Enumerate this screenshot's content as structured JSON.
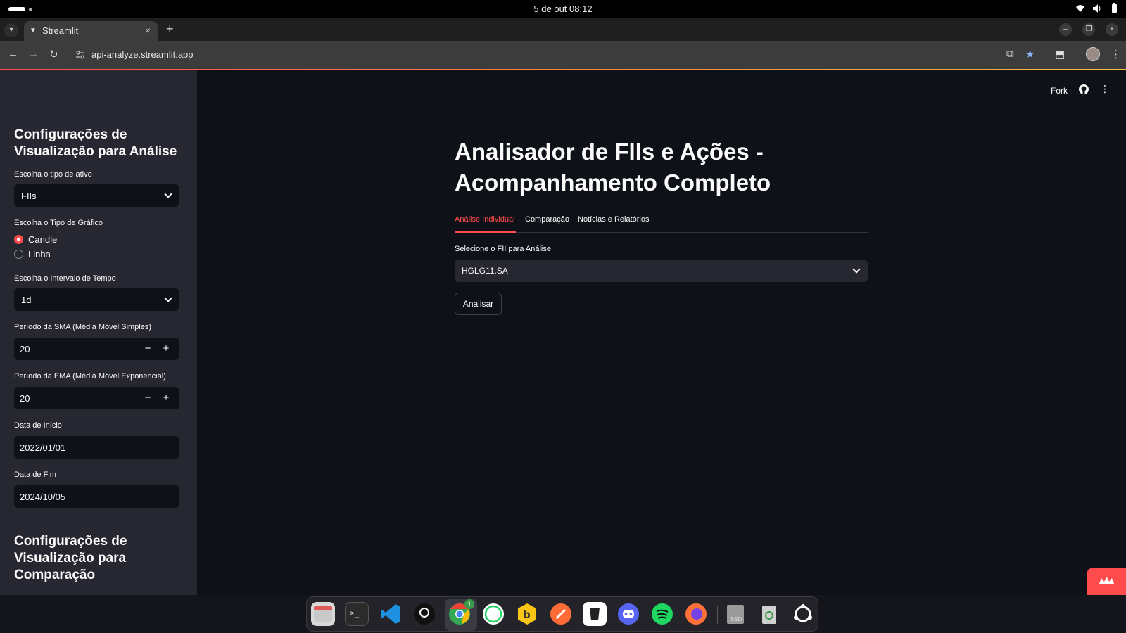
{
  "os": {
    "clock": "5 de out  08:12"
  },
  "browser": {
    "tab_title": "Streamlit",
    "url": "api-analyze.streamlit.app"
  },
  "sidebar": {
    "section1_title": "Configurações de Visualização para Análise",
    "asset_type": {
      "label": "Escolha o tipo de ativo",
      "value": "FIIs"
    },
    "chart_type": {
      "label": "Escolha o Tipo de Gráfico",
      "options": [
        "Candle",
        "Linha"
      ],
      "selected": "Candle"
    },
    "interval": {
      "label": "Escolha o Intervalo de Tempo",
      "value": "1d"
    },
    "sma": {
      "label": "Período da SMA (Média Móvel Simples)",
      "value": "20"
    },
    "ema": {
      "label": "Período da EMA (Média Móvel Exponencial)",
      "value": "20"
    },
    "start_date": {
      "label": "Data de Início",
      "value": "2022/01/01"
    },
    "end_date": {
      "label": "Data de Fim",
      "value": "2024/10/05"
    },
    "section2_title": "Configurações de Visualização para Comparação"
  },
  "header": {
    "fork_label": "Fork"
  },
  "main": {
    "title": "Analisador de FIIs e Ações - Acompanhamento Completo",
    "tabs": [
      {
        "label": "Análise Individual",
        "active": true
      },
      {
        "label": "Comparação",
        "active": false
      },
      {
        "label": "Notícias e Relatórios",
        "active": false
      }
    ],
    "fii_select": {
      "label": "Selecione o FII para Análise",
      "value": "HGLG11.SA"
    },
    "analyze_button": "Analisar"
  },
  "dock": {
    "apps": [
      "files-icon",
      "terminal-icon",
      "vscode-icon",
      "github-icon",
      "chrome-icon",
      "whatsapp-icon",
      "beekeeper-icon",
      "postman-icon",
      "inkscape-icon",
      "discord-icon",
      "spotify-icon",
      "firefox-icon",
      "ssd-icon",
      "trash-icon",
      "apps-grid-icon"
    ],
    "chrome_badge": "1"
  },
  "colors": {
    "accent": "#ff4b4b",
    "sidebar_bg": "#262730",
    "main_bg": "#0e1117"
  }
}
